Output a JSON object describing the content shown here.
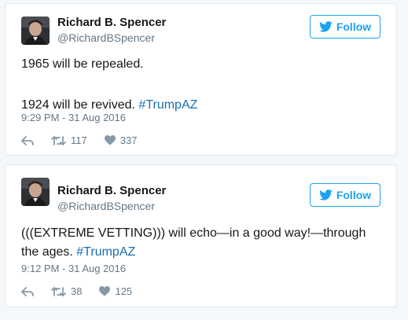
{
  "tweets": [
    {
      "name": "Richard B. Spencer",
      "handle": "@RichardBSpencer",
      "follow_label": "Follow",
      "lines": [
        "1965 will be repealed.",
        "1924 will be revived. "
      ],
      "hashtag": "#TrumpAZ",
      "timestamp": "9:29 PM - 31 Aug 2016",
      "retweets": "117",
      "likes": "337"
    },
    {
      "name": "Richard B. Spencer",
      "handle": "@RichardBSpencer",
      "follow_label": "Follow",
      "text": "(((EXTREME VETTING))) will echo—in a good way!—through the ages. ",
      "hashtag": "#TrumpAZ",
      "timestamp": "9:12 PM - 31 Aug 2016",
      "retweets": "38",
      "likes": "125"
    }
  ],
  "colors": {
    "accent": "#1da1f2",
    "hashtag": "#1b6fb0",
    "secondary_text": "#657786",
    "border": "#e1e8ed"
  },
  "icons": [
    "avatar",
    "twitter-bird-icon",
    "reply-icon",
    "retweet-icon",
    "heart-icon"
  ]
}
